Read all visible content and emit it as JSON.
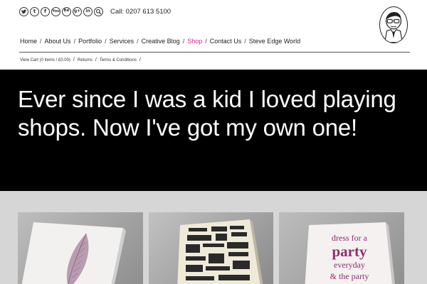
{
  "header": {
    "social_icons": [
      {
        "name": "twitter-icon",
        "glyph": "t"
      },
      {
        "name": "tumblr-icon",
        "glyph": "t"
      },
      {
        "name": "facebook-icon",
        "glyph": "f"
      },
      {
        "name": "youtube-icon",
        "glyph": "You"
      },
      {
        "name": "behance-icon",
        "glyph": "Bē"
      },
      {
        "name": "google-plus-icon",
        "glyph": "g+"
      },
      {
        "name": "linkedin-icon",
        "glyph": "in"
      },
      {
        "name": "search-icon",
        "glyph": ""
      }
    ],
    "call_text": "Call:  0207 613 5100"
  },
  "nav": {
    "items": [
      "Home",
      "About Us",
      "Portfolio",
      "Services",
      "Creative Blog",
      "Shop",
      "Contact Us",
      "Steve Edge World"
    ],
    "active": "Shop",
    "separator": "/",
    "accent_color": "#d2288f"
  },
  "subnav": {
    "items": [
      "View Cart (0 items / £0.00)",
      "Returns",
      "Terms & Conditions"
    ],
    "separator": "/"
  },
  "hero": {
    "text": "Ever since I was a kid I loved playing shops. Now I've got my own one!"
  },
  "products": {
    "card3_poster_text": [
      "dress for a",
      "party",
      "everyday",
      "& the party"
    ]
  }
}
